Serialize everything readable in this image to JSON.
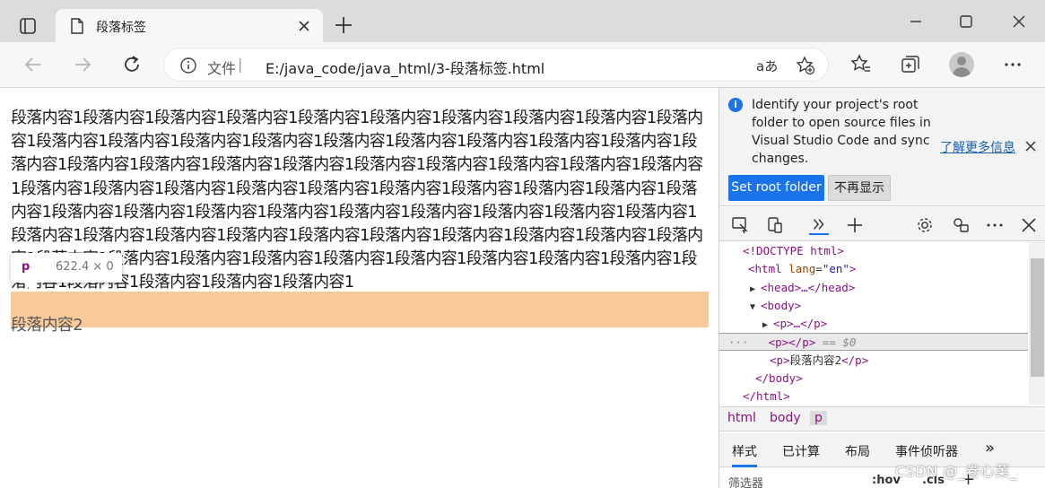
{
  "tab": {
    "title": "段落标签"
  },
  "address": {
    "scheme_label": "文件",
    "separator": "|",
    "url": "E:/java_code/java_html/3-段落标签.html",
    "read_aloud": "aあ"
  },
  "page": {
    "para1": "段落内容1段落内容1段落内容1段落内容1段落内容1段落内容1段落内容1段落内容1段落内容1段落内容1段落内容1段落内容1段落内容1段落内容1段落内容1段落内容1段落内容1段落内容1段落内容1段落内容1段落内容1段落内容1段落内容1段落内容1段落内容1段落内容1段落内容1段落内容1段落内容1段落内容1段落内容1段落内容1段落内容1段落内容1段落内容1段落内容1段落内容1段落内容1段落内容1段落内容1段落内容1段落内容1段落内容1段落内容1段落内容1段落内容1段落内容1段落内容1段落内容1段落内容1段落内容1段落内容1段落内容1段落内容1段落内容1段落内容1段落内容1段落内容1段落内容1段落内容1段落内容1段落内容1段落内容1段落内容1段落内容1段落内容1段落内容1段落内容1段落内容1段落内容1段落内容1段落内容1",
    "para2": "段落内容2",
    "tooltip_tag": "p",
    "tooltip_size": "622.4 × 0"
  },
  "devtools": {
    "infobar": {
      "text": "Identify your project's root folder to open source files in Visual Studio Code and sync changes.",
      "link": "了解更多信息",
      "primary_button": "Set root folder",
      "secondary_button": "不再显示"
    },
    "dom": {
      "doctype": "<!DOCTYPE html>",
      "html_open_tag": "<html",
      "html_attr": "lang",
      "html_attr_val": "\"en\"",
      "html_open_close": ">",
      "head_line": "<head>…</head>",
      "body_open": "<body>",
      "p_collapsed": "<p>…</p>",
      "p_selected": "<p></p>",
      "selected_marker": "== $0",
      "p2_open": "<p>",
      "p2_text": "段落内容2",
      "p2_close": "</p>",
      "body_close": "</body>",
      "html_close": "</html>",
      "ellipsis": "···"
    },
    "breadcrumbs": [
      "html",
      "body",
      "p"
    ],
    "subtabs": [
      "样式",
      "已计算",
      "布局",
      "事件侦听器"
    ],
    "subtabs_more": "»",
    "filter": {
      "placeholder": "筛选器",
      "hov": ":hov",
      "cls": ".cls",
      "plus": "+"
    }
  },
  "watermark": "CSDN @_卷心菜_",
  "colors": {
    "accent": "#1a73e8",
    "highlight": "#f8ca9a",
    "tag": "#881280"
  }
}
